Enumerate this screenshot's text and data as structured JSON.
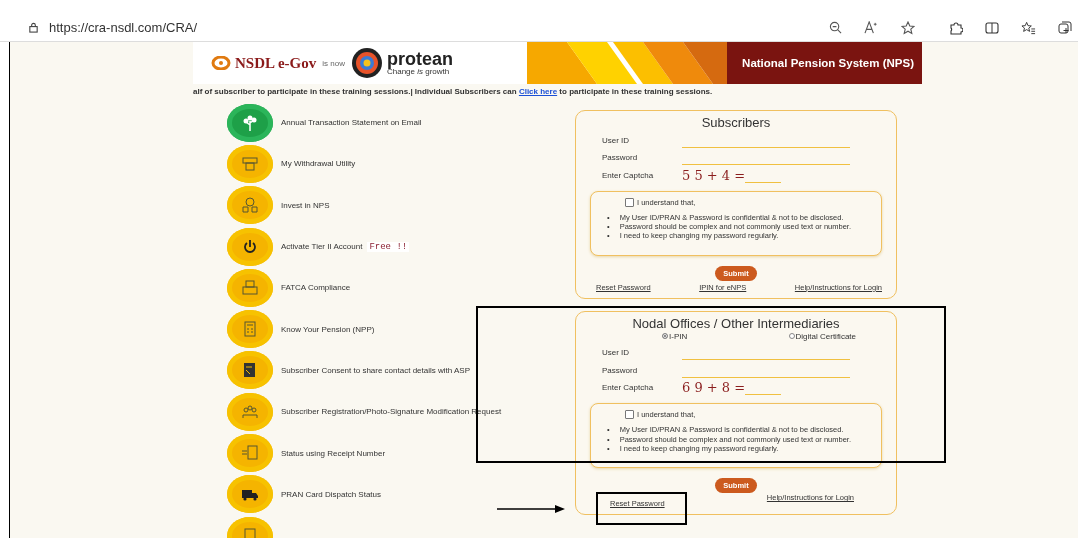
{
  "browser": {
    "url": "https://cra-nsdl.com/CRA/"
  },
  "banner": {
    "brand": "NSDL e-Gov",
    "is_now": "is now",
    "partner": "protean",
    "tagline": "Change *is* growth",
    "title": "National Pension System (NPS)"
  },
  "ticker": {
    "before": "alf of subscriber to participate in these training sessions.| Individual Subscribers can ",
    "link": "Click here",
    "after": " to participate in these training sessions."
  },
  "services": [
    {
      "kind": "leaf",
      "label": "Annual Transaction Statement on Email"
    },
    {
      "kind": "atm",
      "label": "My Withdrawal Utility"
    },
    {
      "kind": "invest",
      "label": "Invest in NPS"
    },
    {
      "kind": "power",
      "label": "Activate Tier II Account",
      "badge": "Free !!"
    },
    {
      "kind": "printer",
      "label": "FATCA Compliance"
    },
    {
      "kind": "calculator",
      "label": "Know Your Pension (NPP)"
    },
    {
      "kind": "clipboard",
      "label": "Subscriber Consent to share contact details with ASP"
    },
    {
      "kind": "people",
      "label": "Subscriber Registration/Photo-Signature Modification Request"
    },
    {
      "kind": "receipt",
      "label": "Status using Receipt Number"
    },
    {
      "kind": "truck",
      "label": "PRAN Card Dispatch Status"
    },
    {
      "kind": "document"
    }
  ],
  "forms": [
    {
      "title": "Subscribers",
      "fields": [
        {
          "label": "User ID"
        },
        {
          "label": "Password"
        }
      ],
      "captcha_label": "Enter Captcha",
      "captcha": "5 5 + 4 =",
      "consent": {
        "label": "I understand that,",
        "checked": false,
        "bullet": "•",
        "points": [
          "My User ID/PRAN & Password is confidential & not to be disclosed.",
          "Password should be complex and not commonly used text or number.",
          "I need to keep changing my password regularly."
        ]
      },
      "submit": "Submit",
      "links": [
        "Reset Password",
        "IPIN for eNPS",
        "Help/Instructions for Login"
      ]
    },
    {
      "title": "Nodal Offices / Other Intermediaries",
      "modes": [
        {
          "label": "I-PIN",
          "selected": true
        },
        {
          "label": "Digital Certificate",
          "selected": false
        }
      ],
      "fields": [
        {
          "label": "User ID"
        },
        {
          "label": "Password"
        }
      ],
      "captcha_label": "Enter Captcha",
      "captcha": "6 9 + 8 =",
      "consent": {
        "label": "I understand that,",
        "checked": false,
        "bullet": "•",
        "points": [
          "My User ID/PRAN & Password is confidential & not to be disclosed.",
          "Password should be complex and not commonly used text or number.",
          "I need to keep changing my password regularly."
        ]
      },
      "submit": "Submit",
      "links": [
        "Reset Password",
        "Help/Instructions for Login"
      ]
    }
  ]
}
